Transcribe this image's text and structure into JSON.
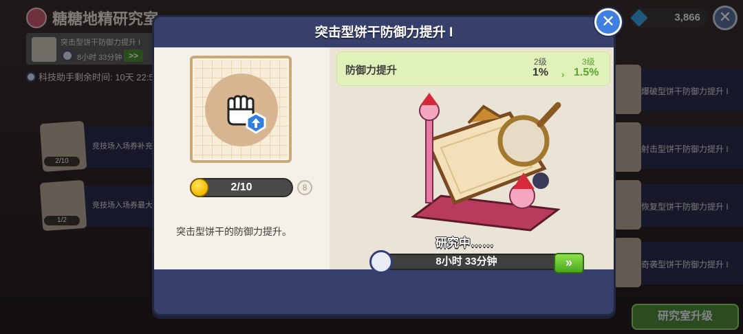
{
  "background": {
    "lab_title": "糖糖地精研究室",
    "current_research": {
      "name": "突击型饼干防御力提升 I",
      "time": "8小时 33分钟",
      "skip_label": ">>"
    },
    "assist_text": "科技助手剩余时间: 10天 22:5",
    "left_items": [
      {
        "text": "竞技场入场券补充",
        "count": "2/10"
      },
      {
        "text": "竞技场入场券最大",
        "count": "1/2"
      }
    ],
    "right_items": [
      {
        "text": "爆破型饼干防御力提升 I"
      },
      {
        "text": "射击型饼干防御力提升 I"
      },
      {
        "text": "恢复型饼干防御力提升 I"
      },
      {
        "text": "奇袭型饼干防御力提升 I"
      }
    ],
    "gems": "3,866",
    "close_label": "✕",
    "upgrade_button": "研究室升级"
  },
  "modal": {
    "title": "突击型饼干防御力提升 I",
    "close_label": "✕",
    "level_progress": "2/10",
    "max_badge": "8",
    "description": "突击型饼干的防御力提升。",
    "stat": {
      "name": "防御力提升",
      "current_level": "2级",
      "current_value": "1%",
      "arrow": "›",
      "next_level": "3级",
      "next_value": "1.5%"
    },
    "status": "研究中……",
    "timer": "8小时 33分钟",
    "speedup_label": "»"
  },
  "colors": {
    "modal_bg": "#37406a",
    "stat_banner": "#dff0b9",
    "accent_green": "#5aa531",
    "close_blue": "#3f7fe0"
  }
}
